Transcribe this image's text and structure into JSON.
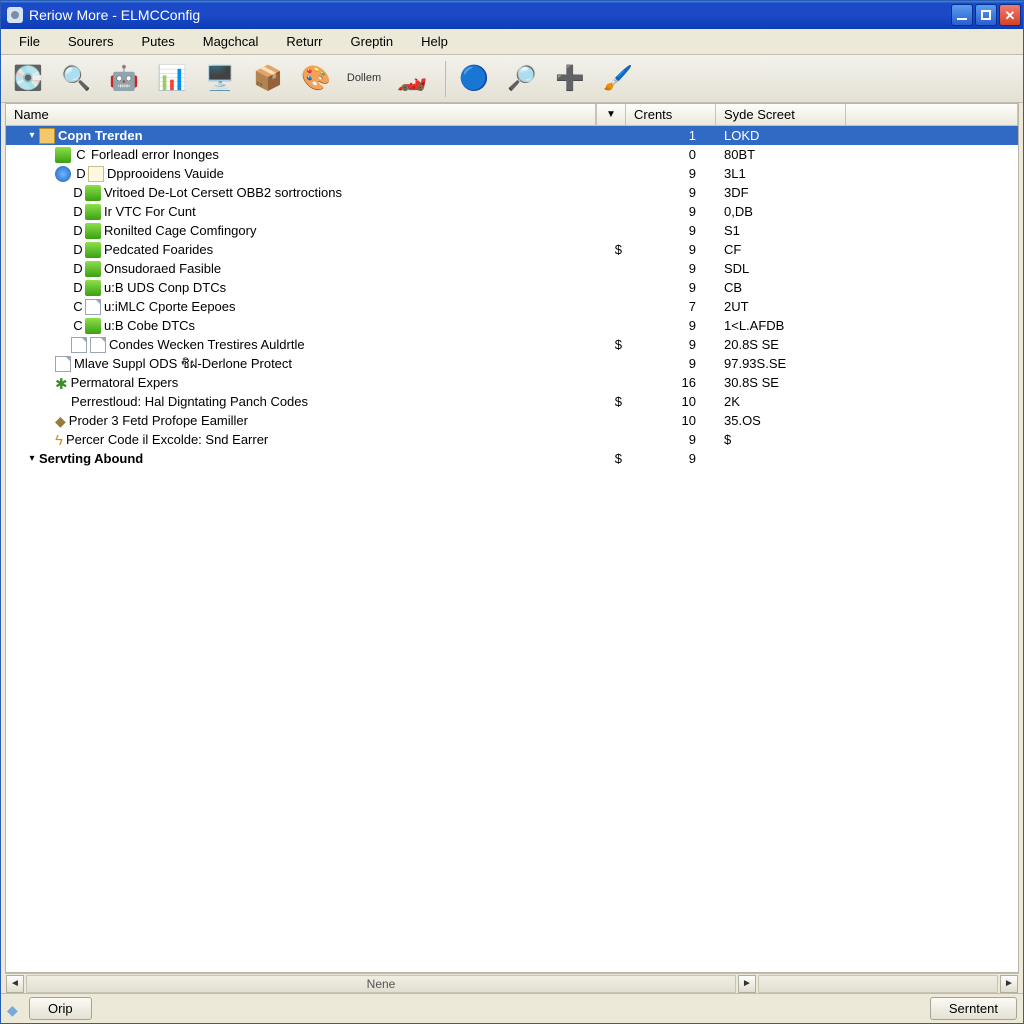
{
  "window": {
    "title": "Reriow More - ELMCConfig"
  },
  "menu": [
    "File",
    "Sourers",
    "Putes",
    "Magchcal",
    "Returr",
    "Greptin",
    "Help"
  ],
  "toolbar": {
    "items": [
      {
        "name": "disk-icon",
        "glyph": "💽"
      },
      {
        "name": "loupe-icon",
        "glyph": "🔍"
      },
      {
        "name": "android-icon",
        "glyph": "🤖"
      },
      {
        "name": "chart-icon",
        "glyph": "📊"
      },
      {
        "name": "monitor-icon",
        "glyph": "🖥️"
      },
      {
        "name": "box-icon",
        "glyph": "📦"
      },
      {
        "name": "palette-icon",
        "glyph": "🎨"
      },
      {
        "name": "dollem-label",
        "glyph": "Dollem",
        "text": true
      },
      {
        "name": "car-icon",
        "glyph": "🏎️"
      }
    ],
    "items2": [
      {
        "name": "globe-icon",
        "glyph": "🔵"
      },
      {
        "name": "zoom-icon",
        "glyph": "🔎"
      },
      {
        "name": "plus-icon",
        "glyph": "➕"
      },
      {
        "name": "brush-icon",
        "glyph": "🖌️"
      }
    ]
  },
  "columns": {
    "name": "Name",
    "crents": "Crents",
    "syde": "Syde Screet"
  },
  "rows": [
    {
      "indent": 1,
      "tw": "▾",
      "icons": [
        "folder"
      ],
      "letter": "",
      "icon2": "",
      "name": "Copn Trerden",
      "dd": "",
      "crents": "1",
      "syde": "LOKD",
      "selected": true,
      "bold": true
    },
    {
      "indent": 2,
      "tw": "",
      "icons": [
        "green"
      ],
      "letter": "C",
      "icon2": "red",
      "name": "Forleadl error Inonges",
      "dd": "",
      "crents": "0",
      "syde": "80BT"
    },
    {
      "indent": 2,
      "tw": "",
      "icons": [
        "blue"
      ],
      "letter": "D",
      "icon2": "note",
      "name": "Dpprooidens Vauide",
      "dd": "",
      "crents": "9",
      "syde": "3L1"
    },
    {
      "indent": 3,
      "tw": "",
      "icons": [],
      "letter": "D",
      "icon2": "green",
      "name": "Vritoed De-Lot Cersett OBB2 sortroctions",
      "dd": "",
      "crents": "9",
      "syde": "3DF"
    },
    {
      "indent": 3,
      "tw": "",
      "icons": [],
      "letter": "D",
      "icon2": "green",
      "name": "Ir VTC For Cunt",
      "dd": "",
      "crents": "9",
      "syde": "0,DB"
    },
    {
      "indent": 3,
      "tw": "",
      "icons": [],
      "letter": "D",
      "icon2": "green",
      "name": "Ronilted Cage Comfingory",
      "dd": "",
      "crents": "9",
      "syde": "S1"
    },
    {
      "indent": 3,
      "tw": "",
      "icons": [],
      "letter": "D",
      "icon2": "green",
      "name": "Pedcated Foarides",
      "dd": "$",
      "crents": "9",
      "syde": "CF"
    },
    {
      "indent": 3,
      "tw": "",
      "icons": [],
      "letter": "D",
      "icon2": "green",
      "name": "Onsudoraed Fasible",
      "dd": "",
      "crents": "9",
      "syde": "SDL"
    },
    {
      "indent": 3,
      "tw": "",
      "icons": [],
      "letter": "D",
      "icon2": "green",
      "name": "u:B UDS Conp DTCs",
      "dd": "",
      "crents": "9",
      "syde": "CB"
    },
    {
      "indent": 3,
      "tw": "",
      "icons": [],
      "letter": "C",
      "icon2": "page",
      "name": "u:iMLC Cporte Eepoes",
      "dd": "",
      "crents": "7",
      "syde": "2UT"
    },
    {
      "indent": 3,
      "tw": "",
      "icons": [],
      "letter": "C",
      "icon2": "green",
      "name": "u:B Cobe DTCs",
      "dd": "",
      "crents": "9",
      "syde": "1<L.AFDB"
    },
    {
      "indent": 3,
      "tw": "",
      "icons": [
        "page"
      ],
      "letter": "",
      "icon2": "page",
      "name": "Condes Wecken Trestires Auldrtle",
      "dd": "$",
      "crents": "9",
      "syde": "20.8S SE"
    },
    {
      "indent": 2,
      "tw": "",
      "icons": [
        "page"
      ],
      "letter": "",
      "icon2": "",
      "name": "Mlave Suppl ODS ชิฝ-Derlone Protect",
      "dd": "",
      "crents": "9",
      "syde": "97.93S.SE"
    },
    {
      "indent": 2,
      "tw": "",
      "icons": [
        "star"
      ],
      "letter": "",
      "icon2": "",
      "name": "Permatoral Expers",
      "dd": "",
      "crents": "16",
      "syde": "30.8S SE",
      "star": "✱"
    },
    {
      "indent": 3,
      "tw": "",
      "icons": [],
      "letter": "",
      "icon2": "",
      "name": "Perrestloud: Hal Digntating Panch Codes",
      "dd": "$",
      "crents": "10",
      "syde": "2K"
    },
    {
      "indent": 2,
      "tw": "",
      "icons": [
        "cube"
      ],
      "letter": "",
      "icon2": "",
      "name": "Proder 3 Fetd Profope Eamiller",
      "dd": "",
      "crents": "10",
      "syde": "35.OS",
      "star": "◆"
    },
    {
      "indent": 2,
      "tw": "",
      "icons": [
        "wand"
      ],
      "letter": "",
      "icon2": "",
      "name": "Percer Code il Excolde: Snd Earrer",
      "dd": "",
      "crents": "9",
      "syde": "$",
      "star": "ϟ"
    },
    {
      "indent": 1,
      "tw": "▾",
      "icons": [],
      "letter": "",
      "icon2": "",
      "name": "Servting Abound",
      "dd": "$",
      "crents": "9",
      "syde": "",
      "bold": true
    }
  ],
  "hscroll": {
    "label": "Nene"
  },
  "statusbar": {
    "left": "Orip",
    "right": "Serntent"
  }
}
